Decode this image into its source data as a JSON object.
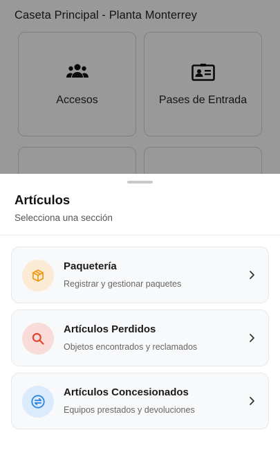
{
  "background": {
    "title": "Caseta Principal - Planta Monterrey",
    "tiles": [
      {
        "label": "Accesos",
        "icon": "users-icon"
      },
      {
        "label": "Pases de Entrada",
        "icon": "id-card-icon"
      }
    ]
  },
  "sheet": {
    "title": "Artículos",
    "subtitle": "Selecciona una sección",
    "options": [
      {
        "title": "Paquetería",
        "description": "Registrar y gestionar paquetes",
        "icon": "package-icon",
        "accent": "#f29a1c",
        "icon_bg": "#fcebd4"
      },
      {
        "title": "Artículos Perdidos",
        "description": "Objetos encontrados y reclamados",
        "icon": "search-icon",
        "accent": "#e0442f",
        "icon_bg": "#f9dcd9"
      },
      {
        "title": "Artículos Concesionados",
        "description": "Equipos prestados y devoluciones",
        "icon": "exchange-icon",
        "accent": "#2a86e0",
        "icon_bg": "#dcebfb"
      }
    ]
  },
  "colors": {
    "overlay": "rgba(0,0,0,0.40)",
    "card_bg": "#f8f9fb",
    "card_border": "#e6e8eb"
  }
}
